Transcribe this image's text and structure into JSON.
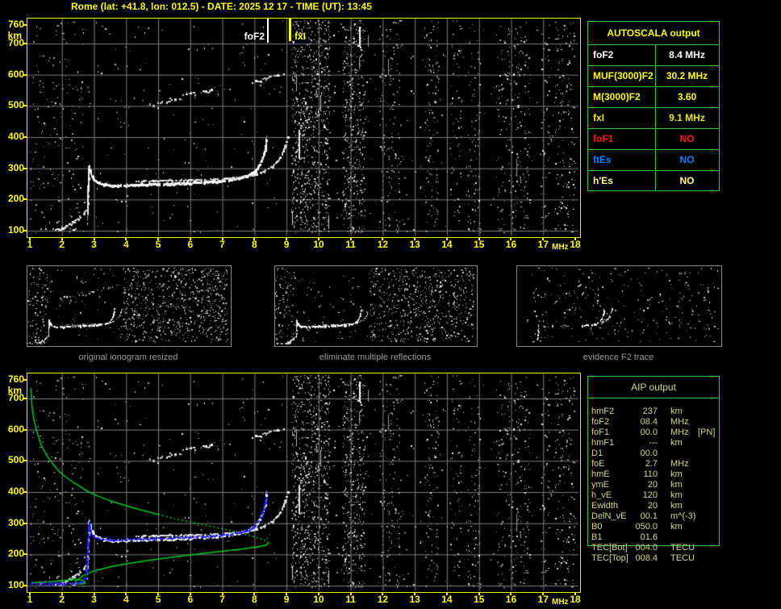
{
  "window": {
    "title": "Rome (lat: +41.8, lon: 012.5) - DATE: 2025 12 17 - TIME (UT): 13:45"
  },
  "axes": {
    "x_ticks": [
      1,
      2,
      3,
      4,
      5,
      6,
      7,
      8,
      9,
      10,
      11,
      12,
      13,
      14,
      15,
      16,
      17,
      18
    ],
    "x_unit": "MHz",
    "y_ticks": [
      760,
      700,
      600,
      500,
      400,
      300,
      200,
      100
    ],
    "y_unit": "km"
  },
  "top_plot": {
    "fof2_label": "foF2",
    "fxi_label": "fxI"
  },
  "autoscala": {
    "title": "AUTOSCALA output",
    "rows": [
      {
        "label": "foF2",
        "value": "8.4 MHz",
        "color": "#ffffff"
      },
      {
        "label": "MUF(3000)F2",
        "value": "30.2 MHz",
        "color": "#ffff00"
      },
      {
        "label": "M(3000)F2",
        "value": "3.60",
        "color": "#ffff00"
      },
      {
        "label": "fxI",
        "value": "9.1 MHz",
        "color": "#e8e800"
      },
      {
        "label": "foF1",
        "value": "NO",
        "color": "#ff1a1a"
      },
      {
        "label": "ftEs",
        "value": "NO",
        "color": "#0080ff"
      },
      {
        "label": "h'Es",
        "value": "NO",
        "color": "#ffff99"
      }
    ]
  },
  "thumbnails": [
    {
      "caption": "original ionogram resized"
    },
    {
      "caption": "eliminate multiple reflections"
    },
    {
      "caption": "evidence F2 trace"
    }
  ],
  "aip": {
    "title": "AIP output",
    "rows": [
      {
        "label": "hmF2",
        "value": "237",
        "unit": "km",
        "extra": ""
      },
      {
        "label": "foF2",
        "value": "08.4",
        "unit": "MHz",
        "extra": ""
      },
      {
        "label": "foF1",
        "value": "00.0",
        "unit": "MHz",
        "extra": "[PN]"
      },
      {
        "label": "hmF1",
        "value": "---",
        "unit": "km",
        "extra": ""
      },
      {
        "label": "D1",
        "value": "00.0",
        "unit": "",
        "extra": ""
      },
      {
        "label": "foE",
        "value": "2.7",
        "unit": "MHz",
        "extra": ""
      },
      {
        "label": "hmE",
        "value": "110",
        "unit": "km",
        "extra": ""
      },
      {
        "label": "ymE",
        "value": "20",
        "unit": "km",
        "extra": ""
      },
      {
        "label": "h_vE",
        "value": "120",
        "unit": "km",
        "extra": ""
      },
      {
        "label": "Ewidth",
        "value": "20",
        "unit": "km",
        "extra": ""
      },
      {
        "label": "DelN_vE",
        "value": "00.1",
        "unit": "m^(-3)",
        "extra": ""
      },
      {
        "label": "B0",
        "value": "050.0",
        "unit": "km",
        "extra": ""
      },
      {
        "label": "B1",
        "value": "01.6",
        "unit": "",
        "extra": ""
      },
      {
        "label": "TEC[Bot]",
        "value": "004.0",
        "unit": "TECU",
        "extra": ""
      },
      {
        "label": "TEC[Top]",
        "value": "008.4",
        "unit": "TECU",
        "extra": ""
      }
    ]
  },
  "colors": {
    "accent_yellow": "#ffff00",
    "grid_gray": "#7d7d7d",
    "table_green": "#33cc33",
    "profile_green": "#00cc22",
    "trace_blue": "#2828ff",
    "trace_blue_dark": "#0000bb",
    "caption_gray": "#9a9a9a",
    "aip_text": "#d6d68c"
  },
  "chart_data": {
    "type": "scatter",
    "title": "ionogram (virtual height vs frequency)",
    "x_unit": "MHz",
    "x_range": [
      1,
      18
    ],
    "y_unit": "km",
    "y_range": [
      100,
      760
    ],
    "markers": {
      "foF2_MHz": 8.4,
      "fxI_MHz": 9.1
    },
    "traces": {
      "base_100km": [
        [
          1.02,
          105
        ],
        [
          1.5,
          106
        ],
        [
          2.0,
          106
        ],
        [
          2.5,
          107
        ]
      ],
      "e_layer": [
        [
          1.85,
          104
        ],
        [
          1.97,
          108
        ],
        [
          2.08,
          113
        ],
        [
          2.18,
          119
        ],
        [
          2.28,
          125
        ],
        [
          2.38,
          130
        ],
        [
          2.47,
          136
        ],
        [
          2.55,
          143
        ],
        [
          2.63,
          150
        ],
        [
          2.7,
          157
        ],
        [
          2.76,
          163
        ]
      ],
      "es_spike": [
        [
          2.8,
          165
        ],
        [
          2.81,
          240
        ],
        [
          2.82,
          306
        ]
      ],
      "f2_ordinary": [
        [
          2.84,
          308
        ],
        [
          2.9,
          285
        ],
        [
          2.98,
          268
        ],
        [
          3.1,
          257
        ],
        [
          3.3,
          250
        ],
        [
          3.6,
          246
        ],
        [
          4.0,
          247
        ],
        [
          4.5,
          249
        ],
        [
          5.0,
          251
        ],
        [
          5.5,
          253
        ],
        [
          6.0,
          255
        ],
        [
          6.5,
          258
        ],
        [
          7.0,
          262
        ],
        [
          7.3,
          266
        ],
        [
          7.6,
          272
        ],
        [
          7.85,
          281
        ],
        [
          8.0,
          292
        ],
        [
          8.1,
          304
        ],
        [
          8.2,
          322
        ],
        [
          8.27,
          342
        ],
        [
          8.32,
          362
        ],
        [
          8.35,
          382
        ],
        [
          8.37,
          398
        ]
      ],
      "f2_extraordinary": [
        [
          4.3,
          259
        ],
        [
          4.8,
          261
        ],
        [
          5.3,
          262
        ],
        [
          5.8,
          263
        ],
        [
          6.3,
          264
        ],
        [
          6.8,
          266
        ],
        [
          7.2,
          269
        ],
        [
          7.6,
          274
        ],
        [
          8.0,
          281
        ],
        [
          8.3,
          292
        ],
        [
          8.55,
          306
        ],
        [
          8.72,
          324
        ],
        [
          8.85,
          345
        ],
        [
          8.93,
          366
        ],
        [
          8.99,
          386
        ],
        [
          9.03,
          399
        ]
      ],
      "oblique_scatter": [
        [
          3.6,
          481
        ],
        [
          8.9,
          601
        ]
      ],
      "scaled_trace_blue": [
        [
          1.0,
          107
        ],
        [
          1.3,
          107
        ],
        [
          1.6,
          107
        ],
        [
          1.9,
          107
        ],
        [
          2.2,
          108
        ],
        [
          2.5,
          108
        ],
        [
          2.62,
          113
        ],
        [
          2.7,
          124
        ],
        [
          2.76,
          150
        ],
        [
          2.79,
          200
        ],
        [
          2.81,
          250
        ],
        [
          2.83,
          296
        ],
        [
          2.85,
          306
        ],
        [
          2.87,
          282
        ],
        [
          2.92,
          264
        ],
        [
          3.05,
          254
        ],
        [
          3.25,
          249
        ],
        [
          3.6,
          246
        ],
        [
          4.0,
          248
        ],
        [
          4.5,
          250
        ],
        [
          5.0,
          252
        ],
        [
          5.5,
          254
        ],
        [
          6.0,
          256
        ],
        [
          6.5,
          258
        ],
        [
          7.0,
          262
        ],
        [
          7.3,
          266
        ],
        [
          7.6,
          272
        ],
        [
          7.85,
          281
        ],
        [
          8.0,
          292
        ],
        [
          8.1,
          304
        ],
        [
          8.2,
          322
        ],
        [
          8.28,
          345
        ],
        [
          8.33,
          368
        ],
        [
          8.36,
          385
        ],
        [
          8.38,
          394
        ]
      ],
      "density_profile_green": [
        [
          1.03,
          733
        ],
        [
          1.07,
          672
        ],
        [
          1.13,
          630
        ],
        [
          1.22,
          593
        ],
        [
          1.35,
          552
        ],
        [
          1.5,
          522
        ],
        [
          1.7,
          492
        ],
        [
          1.95,
          462
        ],
        [
          2.2,
          442
        ],
        [
          2.5,
          422
        ],
        [
          2.8,
          402
        ],
        [
          3.1,
          388
        ],
        [
          3.5,
          372
        ],
        [
          4.0,
          356
        ],
        [
          4.5,
          342
        ],
        [
          5.0,
          328
        ],
        [
          5.5,
          315
        ],
        [
          6.0,
          304
        ],
        [
          6.5,
          293
        ],
        [
          7.0,
          282
        ],
        [
          7.5,
          270
        ],
        [
          7.9,
          259
        ],
        [
          8.2,
          250
        ],
        [
          8.4,
          242
        ],
        [
          8.45,
          237
        ],
        [
          8.35,
          230
        ],
        [
          8.1,
          224
        ],
        [
          7.6,
          217
        ],
        [
          7.0,
          210
        ],
        [
          6.3,
          202
        ],
        [
          5.5,
          192
        ],
        [
          4.7,
          181
        ],
        [
          4.0,
          170
        ],
        [
          3.5,
          160
        ],
        [
          3.1,
          150
        ],
        [
          2.85,
          141
        ],
        [
          2.65,
          131
        ],
        [
          2.52,
          122
        ],
        [
          2.44,
          114
        ],
        [
          2.42,
          110
        ],
        [
          2.5,
          106
        ],
        [
          2.62,
          105
        ],
        [
          2.72,
          108
        ],
        [
          2.7,
          114
        ],
        [
          2.6,
          118
        ],
        [
          2.5,
          120
        ],
        [
          2.3,
          119
        ],
        [
          2.0,
          116
        ],
        [
          1.7,
          113
        ],
        [
          1.4,
          111
        ],
        [
          1.05,
          109
        ]
      ]
    }
  }
}
